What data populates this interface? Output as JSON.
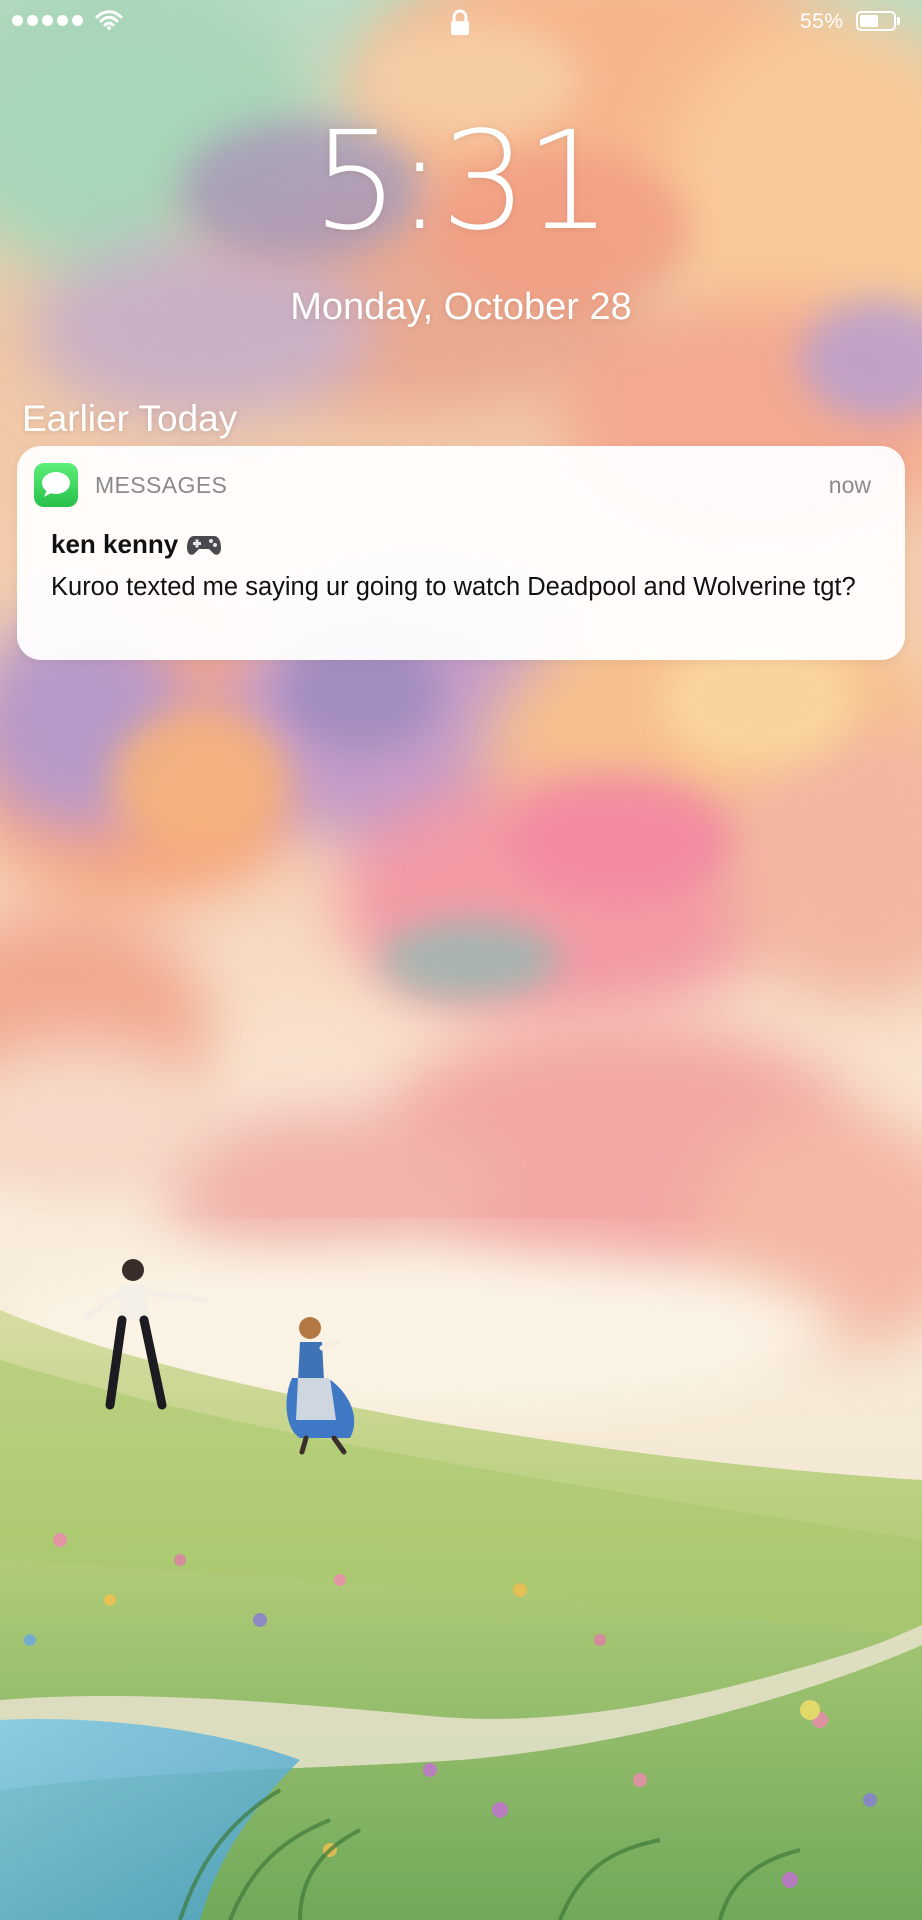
{
  "status_bar": {
    "signal_bars": 5,
    "battery_percent": "55%",
    "battery_level": 0.55,
    "icons": [
      "signal-dots-icon",
      "wifi-icon",
      "lock-icon",
      "battery-icon"
    ]
  },
  "lock_screen": {
    "time": "5:31",
    "date": "Monday, October 28",
    "section_header": "Earlier Today"
  },
  "notification": {
    "app_icon": "messages-app-icon",
    "app_name": "MESSAGES",
    "time": "now",
    "sender": "ken kenny",
    "sender_emoji": "game-controller-icon",
    "message": "Kuroo texted me saying ur going to watch Deadpool and Wolverine tgt?"
  },
  "colors": {
    "notification_bg": "#ffffff",
    "messages_green": "#35c759",
    "secondary_text": "#8a8a8a",
    "primary_text": "#111111"
  }
}
